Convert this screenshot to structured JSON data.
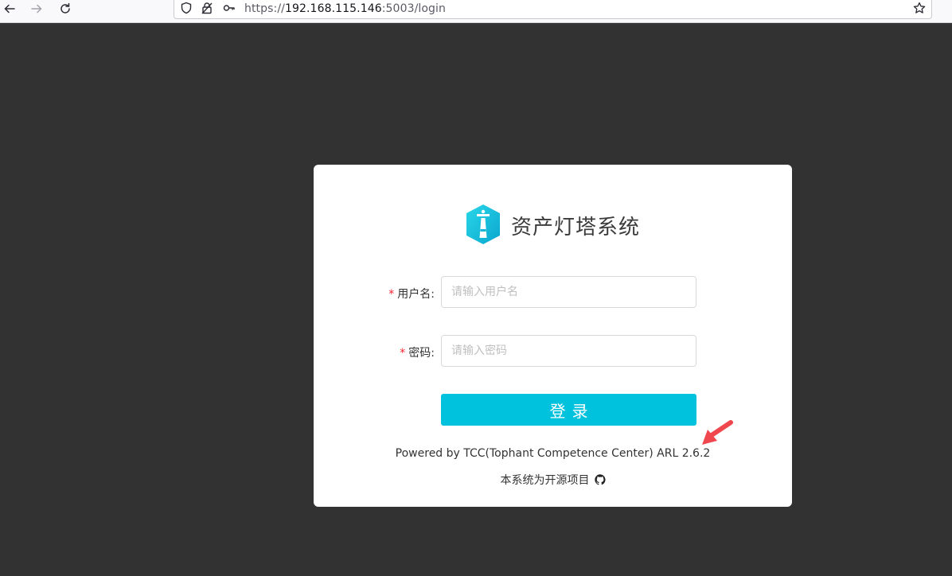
{
  "browser": {
    "url_prefix": "https://",
    "url_host": "192.168.115.146",
    "url_rest": ":5003/login"
  },
  "login": {
    "title": "资产灯塔系统",
    "username_label": "用户名:",
    "username_placeholder": "请输入用户名",
    "password_label": "密码:",
    "password_placeholder": "请输入密码",
    "required_mark": "*",
    "submit_label": "登录",
    "powered_by": "Powered by TCC(Tophant Competence Center) ARL 2.6.2",
    "open_source": "本系统为开源项目"
  },
  "colors": {
    "page_background": "#323232",
    "accent": "#00c2dd",
    "required": "#f5222d",
    "annotation_arrow": "#f0474f"
  },
  "icons": {
    "back": "arrow-left-icon",
    "forward": "arrow-right-icon",
    "reload": "reload-icon",
    "shield": "tracking-shield-icon",
    "insecure_lock": "insecure-lock-icon",
    "key": "key-icon",
    "bookmark": "star-icon",
    "logo": "lighthouse-logo-icon",
    "github": "github-icon",
    "annotation": "red-arrow-icon"
  }
}
